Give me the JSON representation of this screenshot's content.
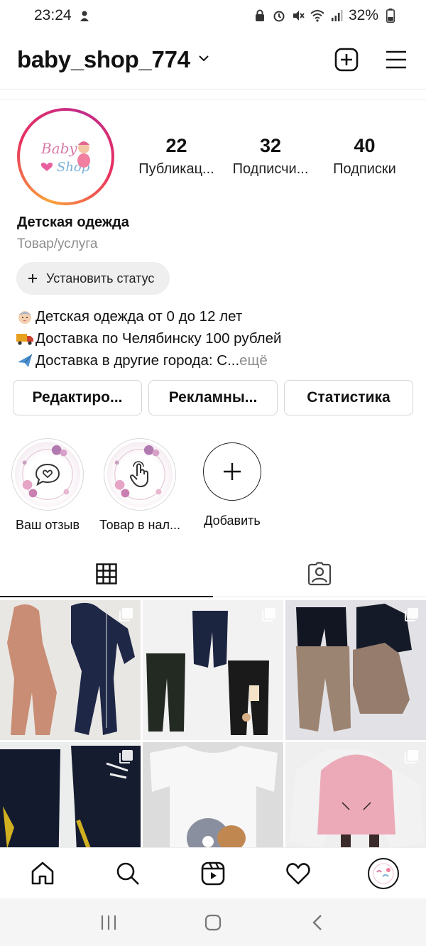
{
  "status_bar": {
    "time": "23:24",
    "battery": "32%"
  },
  "header": {
    "username": "baby_shop_774"
  },
  "profile": {
    "stats": [
      {
        "value": "22",
        "label": "Публикац..."
      },
      {
        "value": "32",
        "label": "Подписчи..."
      },
      {
        "value": "40",
        "label": "Подписки"
      }
    ],
    "name": "Детская одежда",
    "category": "Товар/услуга",
    "status_button": "Установить статус",
    "bio": [
      "Детская одежда от 0 до 12 лет",
      "Доставка по Челябинску 100 рублей",
      "Доставка в другие города: С..."
    ],
    "bio_more": " ещё",
    "avatar_text_1": "Baby",
    "avatar_text_2": "Shop"
  },
  "actions": [
    "Редактиро...",
    "Рекламны...",
    "Статистика"
  ],
  "highlights": [
    {
      "label": "Ваш отзыв",
      "icon": "chat-heart-icon"
    },
    {
      "label": "Товар в нал...",
      "icon": "hand-tap-icon"
    },
    {
      "label": "Добавить",
      "icon": "plus-icon"
    }
  ],
  "tabs": [
    {
      "name": "grid",
      "icon": "grid-icon",
      "active": true
    },
    {
      "name": "tagged",
      "icon": "tagged-person-icon",
      "active": false
    }
  ],
  "posts": [
    {
      "subject": "pink and navy jumpsuits"
    },
    {
      "subject": "black leggings with patches"
    },
    {
      "subject": "black and beige tracksuits"
    },
    {
      "subject": "navy sports pants"
    },
    {
      "subject": "tom and jerry t-shirt"
    },
    {
      "subject": "pink cat hoodie"
    }
  ],
  "colors": {
    "accent": "#e8305f",
    "gradient_start": "#f9a33a",
    "muted": "#8e8e8e"
  }
}
